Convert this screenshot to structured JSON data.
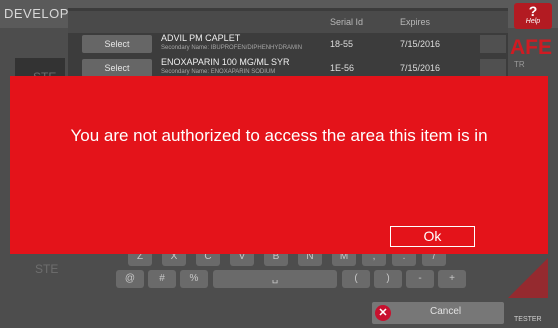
{
  "app": {
    "title": "DEVELOP",
    "help_symbol": "?",
    "help_label": "Help"
  },
  "background": {
    "ste_top": "STE",
    "ste_bottom": "STE",
    "logo": "AFE",
    "logo_sub": "TR",
    "tester_label": "TESTER"
  },
  "table": {
    "headers": {
      "serial": "Serial Id",
      "expires": "Expires"
    },
    "rows": [
      {
        "select": "Select",
        "name": "ADVIL PM CAPLET",
        "secondary": "Secondary Name: IBUPROFEN/DIPHENHYDRAMIN",
        "serial": "18-55",
        "expires": "7/15/2016"
      },
      {
        "select": "Select",
        "name": "ENOXAPARIN 100 MG/ML SYR",
        "secondary": "Secondary Name: ENOXAPARIN SODIUM",
        "serial": "1E-56",
        "expires": "7/15/2016"
      }
    ]
  },
  "keyboard": {
    "row1": [
      "Z",
      "X",
      "C",
      "V",
      "B",
      "N",
      "M",
      ",",
      ".",
      "/"
    ],
    "row2": {
      "at": "@",
      "hash": "#",
      "percent": "%",
      "space": "␣",
      "lparen": "(",
      "rparen": ")",
      "minus": "-",
      "plus": "+"
    }
  },
  "cancel": {
    "label": "Cancel",
    "icon": "close-icon"
  },
  "alert": {
    "message": "You are not authorized to access the area this item is in",
    "ok": "Ok",
    "color": "#e4131a"
  }
}
